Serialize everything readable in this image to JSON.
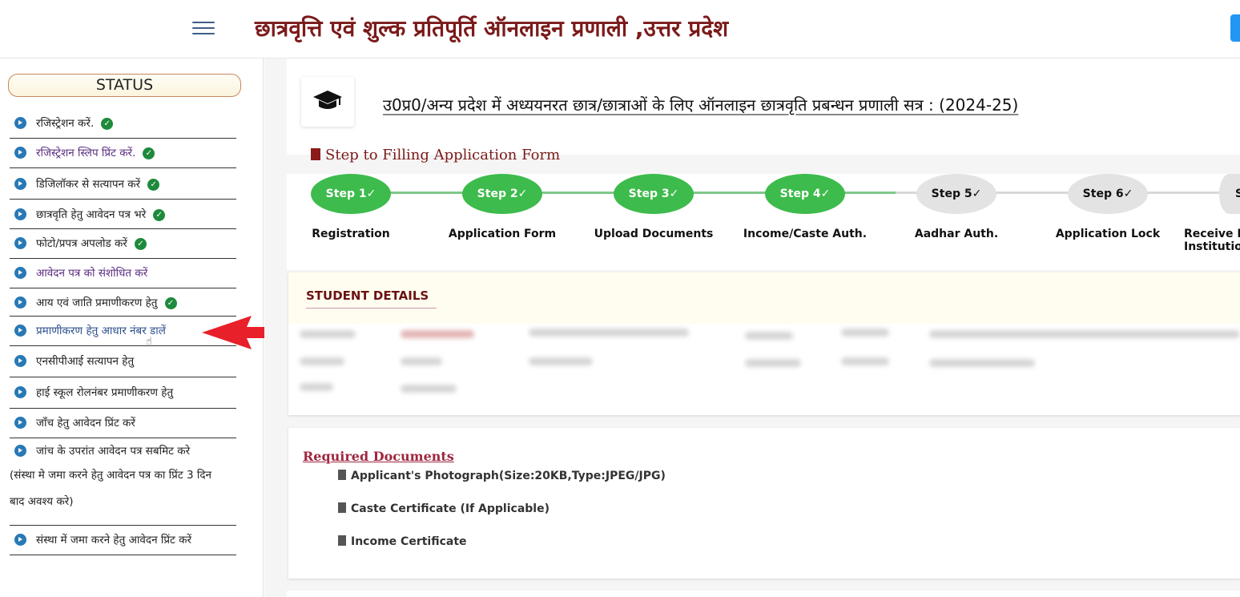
{
  "header": {
    "title": "छात्रवृत्ति एवं शुल्क प्रतिपूर्ति ऑनलाइन प्रणाली ,उत्तर प्रदेश",
    "menu_icon": "hamburger-icon"
  },
  "sidebar": {
    "status_label": "STATUS",
    "items": [
      {
        "label": "रजिस्ट्रेशन करें.",
        "completed": true
      },
      {
        "label": "रजिस्ट्रेशन स्लिप प्रिंट करें.",
        "completed": true
      },
      {
        "label": "डिजिलॉकर से सत्यापन करें",
        "completed": true
      },
      {
        "label": "छात्रवृति हेतु आवेदन पत्र भरे",
        "completed": true
      },
      {
        "label": "फोटो/प्रपत्र अपलोड करें",
        "completed": true
      },
      {
        "label": "आवेदन पत्र को संशोधित करें",
        "completed": false
      },
      {
        "label": "आय एवं जाति प्रमाणीकरण हेतु",
        "completed": true
      },
      {
        "label": "प्रमाणीकरण हेतु आधार नंबर डालें",
        "completed": false
      },
      {
        "label": "एनसीपीआई सत्यापन हेतु",
        "completed": false
      },
      {
        "label": "हाई स्कूल रोलनंबर प्रमाणीकरण हेतु",
        "completed": false
      },
      {
        "label": "जाँच हेतु आवेदन प्रिंट करें",
        "completed": false
      },
      {
        "label": "जांच के उपरांत आवेदन पत्र सबमिट करे",
        "note_line1": "(संस्था मे जमा करने हेतु आवेदन पत्र का प्रिंट 3 दिन",
        "note_line2": "बाद अवश्य करे)",
        "completed": false
      },
      {
        "label": "संस्था में जमा करने हेतु आवेदन प्रिंट करें",
        "completed": false
      }
    ]
  },
  "main": {
    "heading": "उ0प्र0/अन्य प्रदेश में अध्ययनरत छात्र/छात्राओं के लिए ऑनलाइन छात्रवृति प्रबन्धन प्रणाली सत्र : (2024-25)",
    "steps_title": "Step to Filling Application Form",
    "steps": [
      {
        "name": "Step 1",
        "label": "Registration",
        "completed": true
      },
      {
        "name": "Step 2",
        "label": "Application Form",
        "completed": true
      },
      {
        "name": "Step 3",
        "label": "Upload Documents",
        "completed": true
      },
      {
        "name": "Step 4",
        "label": "Income/Caste Auth.",
        "completed": true
      },
      {
        "name": "Step 5",
        "label": "Aadhar Auth.",
        "completed": false
      },
      {
        "name": "Step 6",
        "label": "Application Lock",
        "completed": false
      },
      {
        "name": "S",
        "label": "Receive H",
        "label2": "Institution",
        "completed": false
      }
    ],
    "student_details_title": "STUDENT DETAILS",
    "required_documents_title": "Required Documents",
    "documents": [
      "Applicant's Photograph(Size:20KB,Type:JPEG/JPG)",
      "Caste Certificate (If Applicable)",
      "Income Certificate"
    ]
  },
  "colors": {
    "title": "#7b1a1a",
    "step_done": "#3dbb4c",
    "step_todo": "#e3e3e3",
    "check": "#1e8a3c",
    "bullet": "#2879b5",
    "arrow": "#e8202a"
  }
}
